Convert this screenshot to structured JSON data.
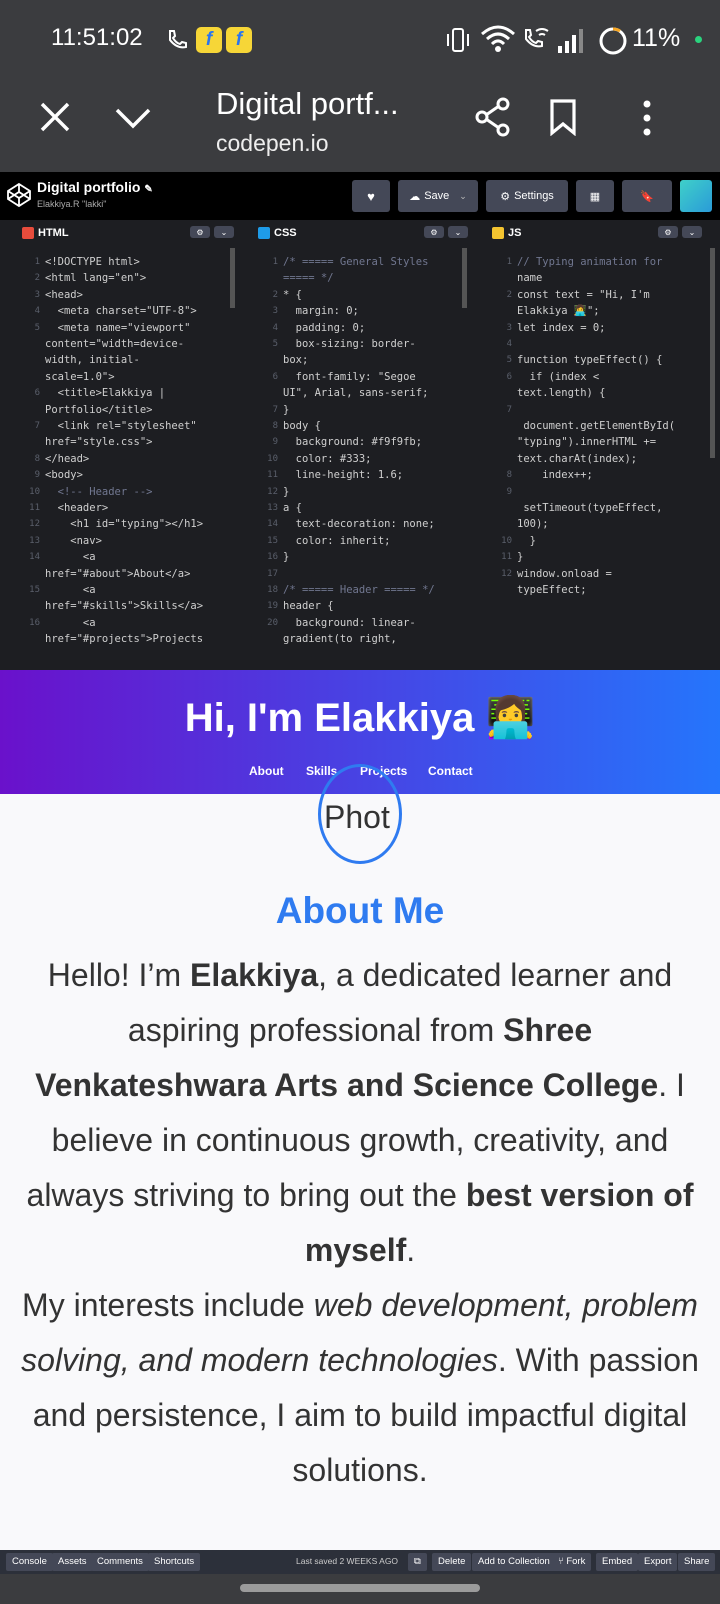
{
  "status_bar": {
    "time": "11:51:02",
    "battery": "11%",
    "icons": [
      "call-icon",
      "flipkart-icon",
      "flipkart-icon",
      "vibrate-icon",
      "wifi-icon",
      "wifi-call-icon",
      "signal-icon",
      "battery-icon"
    ]
  },
  "browser": {
    "page_title": "Digital portf...",
    "url": "codepen.io"
  },
  "codepen": {
    "title": "Digital portfolio",
    "user": "Elakkiya.R \"lakki\"",
    "save_label": "Save",
    "settings_label": "Settings",
    "tabs": {
      "html": "HTML",
      "css": "CSS",
      "js": "JS"
    }
  },
  "code": {
    "html_lines": [
      {
        "n": "1",
        "t": "<!DOCTYPE html>"
      },
      {
        "n": "2",
        "t": "<html lang=\"en\">"
      },
      {
        "n": "3",
        "t": "<head>"
      },
      {
        "n": "4",
        "t": "  <meta charset=\"UTF-8\">"
      },
      {
        "n": "5",
        "t": "  <meta name=\"viewport\""
      },
      {
        "n": "",
        "t": "content=\"width=device-"
      },
      {
        "n": "",
        "t": "width, initial-"
      },
      {
        "n": "",
        "t": "scale=1.0\">"
      },
      {
        "n": "6",
        "t": "  <title>Elakkiya |"
      },
      {
        "n": "",
        "t": "Portfolio</title>"
      },
      {
        "n": "7",
        "t": "  <link rel=\"stylesheet\""
      },
      {
        "n": "",
        "t": "href=\"style.css\">"
      },
      {
        "n": "8",
        "t": "</head>"
      },
      {
        "n": "9",
        "t": "<body>"
      },
      {
        "n": "10",
        "t": "  <!-- Header -->"
      },
      {
        "n": "11",
        "t": "  <header>"
      },
      {
        "n": "12",
        "t": "    <h1 id=\"typing\"></h1>"
      },
      {
        "n": "13",
        "t": "    <nav>"
      },
      {
        "n": "14",
        "t": "      <a"
      },
      {
        "n": "",
        "t": "href=\"#about\">About</a>"
      },
      {
        "n": "15",
        "t": "      <a"
      },
      {
        "n": "",
        "t": "href=\"#skills\">Skills</a>"
      },
      {
        "n": "16",
        "t": "      <a"
      },
      {
        "n": "",
        "t": "href=\"#projects\">Projects"
      }
    ],
    "css_lines": [
      {
        "n": "1",
        "t": "/* ===== General Styles"
      },
      {
        "n": "",
        "t": "===== */"
      },
      {
        "n": "2",
        "t": "* {"
      },
      {
        "n": "3",
        "t": "  margin: 0;"
      },
      {
        "n": "4",
        "t": "  padding: 0;"
      },
      {
        "n": "5",
        "t": "  box-sizing: border-"
      },
      {
        "n": "",
        "t": "box;"
      },
      {
        "n": "6",
        "t": "  font-family: \"Segoe"
      },
      {
        "n": "",
        "t": "UI\", Arial, sans-serif;"
      },
      {
        "n": "7",
        "t": "}"
      },
      {
        "n": "8",
        "t": "body {"
      },
      {
        "n": "9",
        "t": "  background: #f9f9fb;"
      },
      {
        "n": "10",
        "t": "  color: #333;"
      },
      {
        "n": "11",
        "t": "  line-height: 1.6;"
      },
      {
        "n": "12",
        "t": "}"
      },
      {
        "n": "13",
        "t": "a {"
      },
      {
        "n": "14",
        "t": "  text-decoration: none;"
      },
      {
        "n": "15",
        "t": "  color: inherit;"
      },
      {
        "n": "16",
        "t": "}"
      },
      {
        "n": "17",
        "t": ""
      },
      {
        "n": "18",
        "t": "/* ===== Header ===== */"
      },
      {
        "n": "19",
        "t": "header {"
      },
      {
        "n": "20",
        "t": "  background: linear-"
      },
      {
        "n": "",
        "t": "gradient(to right,"
      }
    ],
    "js_lines": [
      {
        "n": "1",
        "t": "// Typing animation for"
      },
      {
        "n": "",
        "t": "name"
      },
      {
        "n": "2",
        "t": "const text = \"Hi, I'm"
      },
      {
        "n": "",
        "t": "Elakkiya 👩‍💻\";"
      },
      {
        "n": "3",
        "t": "let index = 0;"
      },
      {
        "n": "4",
        "t": ""
      },
      {
        "n": "5",
        "t": "function typeEffect() {"
      },
      {
        "n": "6",
        "t": "  if (index <"
      },
      {
        "n": "",
        "t": "text.length) {"
      },
      {
        "n": "7",
        "t": ""
      },
      {
        "n": "",
        "t": " document.getElementById("
      },
      {
        "n": "",
        "t": "\"typing\").innerHTML +="
      },
      {
        "n": "",
        "t": "text.charAt(index);"
      },
      {
        "n": "8",
        "t": "    index++;"
      },
      {
        "n": "9",
        "t": ""
      },
      {
        "n": "",
        "t": " setTimeout(typeEffect,"
      },
      {
        "n": "",
        "t": "100);"
      },
      {
        "n": "10",
        "t": "  }"
      },
      {
        "n": "11",
        "t": "}"
      },
      {
        "n": "12",
        "t": "window.onload ="
      },
      {
        "n": "",
        "t": "typeEffect;"
      }
    ]
  },
  "preview": {
    "heading": "Hi, I'm Elakkiya 👩‍💻",
    "nav": [
      "About",
      "Skills",
      "Projects",
      "Contact"
    ],
    "photo_text": "Phot",
    "about_title": "About Me",
    "p1_a": "Hello! I’m ",
    "p1_b": "Elakkiya",
    "p1_c": ", a dedicated learner and aspiring professional from ",
    "p1_d": "Shree Venkateshwara Arts and Science College",
    "p1_e": ". I believe in continuous growth, creativity, and always striving to bring out the ",
    "p1_f": "best version of myself",
    "p1_g": ".",
    "p2_a": "My interests include ",
    "p2_b": "web development, problem solving, and modern technologies",
    "p2_c": ". With passion and persistence, I aim to build impactful digital solutions."
  },
  "bottom_bar": {
    "console": "Console",
    "assets": "Assets",
    "comments": "Comments",
    "shortcuts": "Shortcuts",
    "last_saved": "Last saved 2 WEEKS AGO",
    "delete": "Delete",
    "add_collection": "Add to Collection",
    "fork": "Fork",
    "embed": "Embed",
    "export": "Export",
    "share": "Share"
  }
}
